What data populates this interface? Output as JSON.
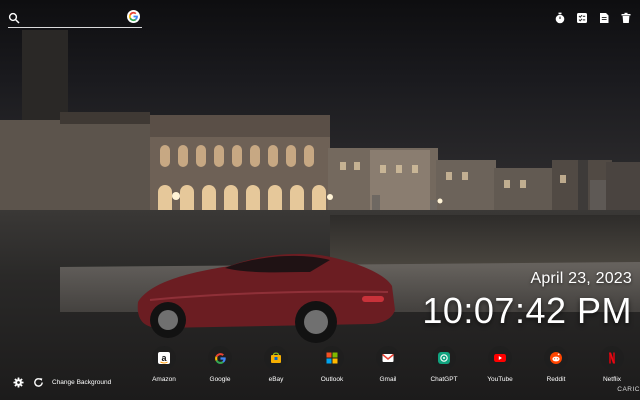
{
  "search": {
    "placeholder": "",
    "value": "",
    "engine_icon": "google-g-icon"
  },
  "toolbar_icons": [
    "timer-icon",
    "todo-icon",
    "notes-icon",
    "trash-icon"
  ],
  "clock": {
    "date": "April 23, 2023",
    "time": "10:07:42 PM"
  },
  "shortcuts": [
    {
      "label": "Amazon",
      "icon": "amazon-icon",
      "color": "#ffffff"
    },
    {
      "label": "Google",
      "icon": "google-icon",
      "color": "#4285f4"
    },
    {
      "label": "eBay",
      "icon": "ebay-icon",
      "color": "#f5af02"
    },
    {
      "label": "Outlook",
      "icon": "outlook-icon",
      "color": "#0078d4"
    },
    {
      "label": "Gmail",
      "icon": "gmail-icon",
      "color": "#ea4335"
    },
    {
      "label": "ChatGPT",
      "icon": "chatgpt-icon",
      "color": "#10a37f"
    },
    {
      "label": "YouTube",
      "icon": "youtube-icon",
      "color": "#ff0000"
    },
    {
      "label": "Reddit",
      "icon": "reddit-icon",
      "color": "#ff4500"
    },
    {
      "label": "Netflix",
      "icon": "netflix-icon",
      "color": "#e50914"
    }
  ],
  "footer": {
    "settings_icon": "gear-icon",
    "refresh_icon": "refresh-icon",
    "change_background": "Change Background",
    "credit": "CARIC"
  },
  "colors": {
    "text": "#ffffff",
    "car": "#6b1d22"
  }
}
